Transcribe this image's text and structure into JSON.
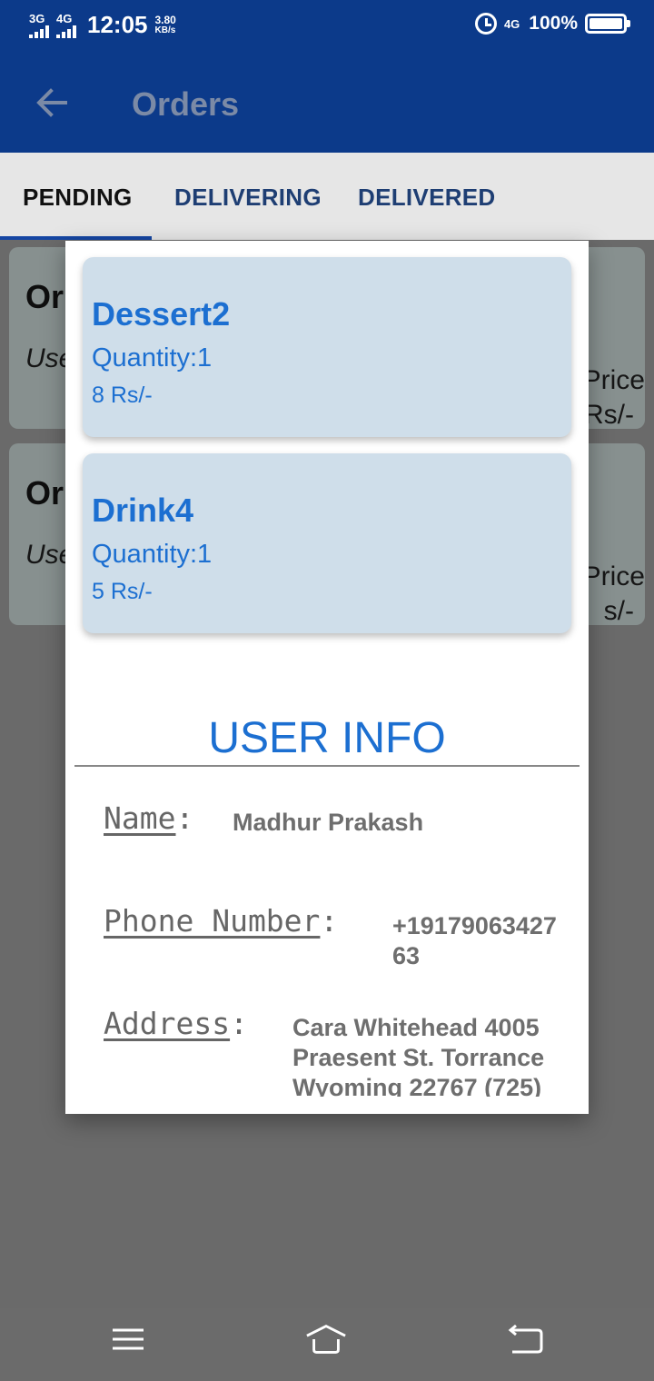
{
  "status_bar": {
    "net1": "3G",
    "net2": "4G",
    "time": "12:05",
    "speed_value": "3.80",
    "speed_unit": "KB/s",
    "net_right": "4G",
    "battery_percent": "100%"
  },
  "app_bar": {
    "title": "Orders"
  },
  "tabs": [
    {
      "label": "PENDING",
      "active": true
    },
    {
      "label": "DELIVERING",
      "active": false
    },
    {
      "label": "DELIVERED",
      "active": false
    }
  ],
  "background_cards": [
    {
      "title_fragment": "Or",
      "sub_fragment": "Use",
      "price_fragment": "Price",
      "price_value_fragment": "Rs/-"
    },
    {
      "title_fragment": "Or",
      "sub_fragment": "Use",
      "price_fragment": "Price",
      "price_value_fragment": "s/-"
    }
  ],
  "dialog": {
    "items": [
      {
        "name": "Dessert2",
        "quantity": "Quantity:1",
        "price": "8 Rs/-"
      },
      {
        "name": "Drink4",
        "quantity": "Quantity:1",
        "price": "5 Rs/-"
      }
    ],
    "section_title": "USER INFO",
    "name_label": "Name",
    "name_value": "Madhur Prakash",
    "phone_label": "Phone Number",
    "phone_value_line1": "+19179063427",
    "phone_value_line2": "63",
    "address_label": "Address",
    "address_line1": "Cara Whitehead 4005",
    "address_line2": "Praesent St. Torrance",
    "address_line3": "Wyoming 22767 (725)"
  },
  "colors": {
    "primary": "#0c3a8a",
    "accent_text": "#1c6fd1",
    "item_card_bg": "#cfdeea"
  },
  "icons": {
    "back": "arrow-left-icon",
    "alarm": "alarm-icon",
    "battery": "battery-icon",
    "menu": "menu-icon",
    "home": "home-icon",
    "nav_back": "back-icon"
  }
}
